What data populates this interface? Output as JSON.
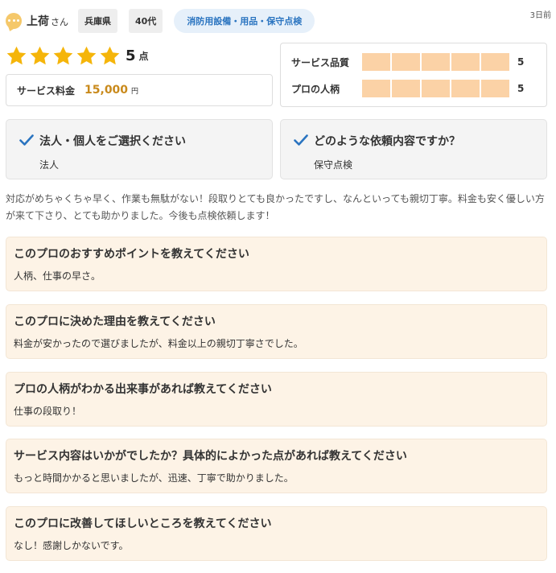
{
  "reviewer": {
    "name": "上荷",
    "name_suffix": "さん",
    "prefecture": "兵庫県",
    "age": "40代",
    "category": "消防用設備・用品・保守点検",
    "posted": "3日前"
  },
  "rating": {
    "stars": 5,
    "score": "5",
    "unit": "点"
  },
  "fee": {
    "label": "サービス料金",
    "value": "15,000",
    "unit": "円"
  },
  "sub_ratings": [
    {
      "label": "サービス品質",
      "value": "5",
      "level": 5
    },
    {
      "label": "プロの人柄",
      "value": "5",
      "level": 5
    }
  ],
  "qa": [
    {
      "question": "法人・個人をご選択ください",
      "answer": "法人"
    },
    {
      "question": "どのような依頼内容ですか？",
      "answer": "保守点検"
    }
  ],
  "comment": "対応がめちゃくちゃ早く、作業も無駄がない！段取りとても良かったですし、なんといっても親切丁寧。料金も安く優しい方が来て下さり、とても助かりました。今後も点検依頼します！",
  "cards": [
    {
      "question": "このプロのおすすめポイントを教えてください",
      "answer": "人柄、仕事の早さ。"
    },
    {
      "question": "このプロに決めた理由を教えてください",
      "answer": "料金が安かったので選びましたが、料金以上の親切丁寧さでした。"
    },
    {
      "question": "プロの人柄がわかる出来事があれば教えてください",
      "answer": "仕事の段取り！"
    },
    {
      "question": "サービス内容はいかがでしたか？具体的によかった点があれば教えてください",
      "answer": "もっと時間かかると思いましたが、迅速、丁寧で助かりました。"
    },
    {
      "question": "このプロに改善してほしいところを教えてください",
      "answer": "なし！感謝しかないです。"
    }
  ],
  "colors": {
    "star": "#f5b50a",
    "bar_fill": "#fbd2a6",
    "fee_value": "#c98a1c",
    "category_bg": "#e6f0fa",
    "category_text": "#2a74c0",
    "check": "#2a74c0",
    "card_bg": "#fdf3e6"
  },
  "icons": {
    "avatar": "speech-bubble-icon",
    "star": "star-icon",
    "check": "check-icon"
  }
}
